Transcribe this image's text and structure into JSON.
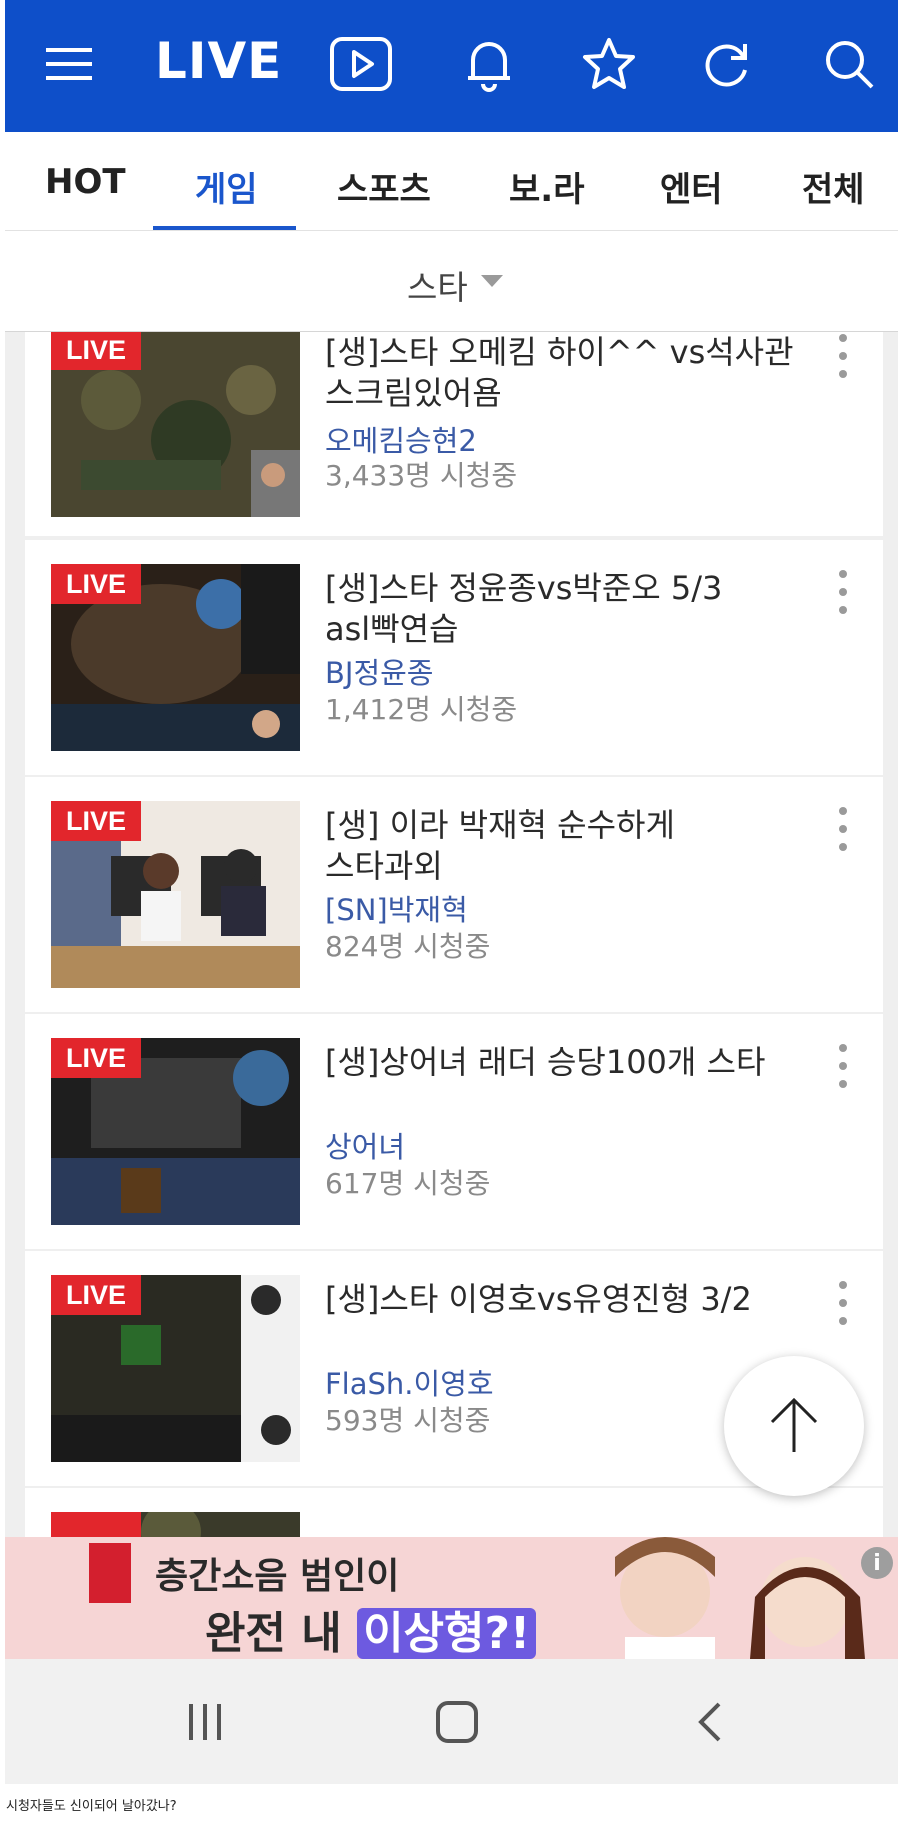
{
  "app": {
    "title": "LIVE"
  },
  "tabs": [
    {
      "label": "HOT"
    },
    {
      "label": "게임"
    },
    {
      "label": "스포츠"
    },
    {
      "label": "보.라"
    },
    {
      "label": "엔터"
    },
    {
      "label": "전체"
    }
  ],
  "filter": {
    "label": "스타"
  },
  "badge": {
    "live": "LIVE"
  },
  "streams": [
    {
      "title1": "[생]스타 오메킴 하이^^ vs석사관",
      "title2": "스크림있어욤",
      "channel": "오메킴승현2",
      "viewers": "3,433명 시청중"
    },
    {
      "title1": "[생]스타 정윤종vs박준오 5/3",
      "title2": "asl빡연습",
      "channel": "BJ정윤종",
      "viewers": "1,412명 시청중"
    },
    {
      "title1": "[생] 이라 박재혁 순수하게",
      "title2": "스타과외",
      "channel": "[SN]박재혁",
      "viewers": "824명 시청중"
    },
    {
      "title1": "[생]상어녀 래더 승당100개 스타",
      "title2": "",
      "channel": "상어녀",
      "viewers": "617명 시청중"
    },
    {
      "title1": "[생]스타 이영호vs유영진형 3/2",
      "title2": "",
      "channel": "FlaSh.이영호",
      "viewers": "593명 시청중"
    }
  ],
  "banner": {
    "line1": "층간소음 범인이",
    "line2a": "완전 내 ",
    "line2b": "이상형?!"
  },
  "caption": "시청자들도 신이되어 날아갔나?",
  "colors": {
    "topbar": "#0e4fc9",
    "active_tab": "#1a56cc",
    "live_badge": "#e2262c",
    "channel_text": "#3a5aa6"
  }
}
